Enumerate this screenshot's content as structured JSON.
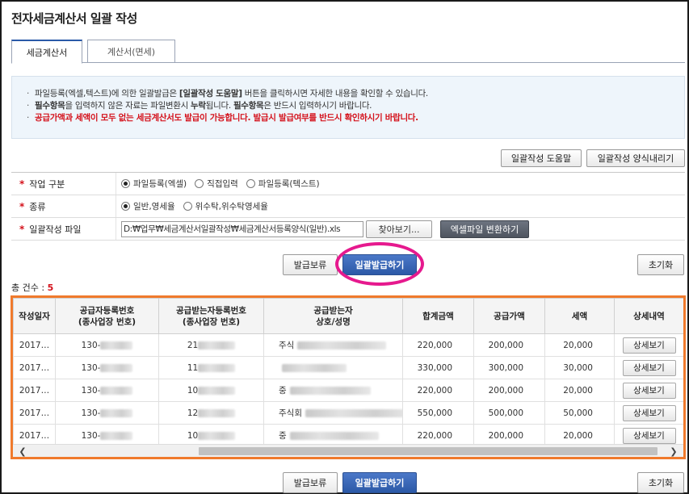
{
  "page": {
    "title": "전자세금계산서 일괄 작성"
  },
  "tabs": [
    {
      "label": "세금계산서",
      "active": true
    },
    {
      "label": "계산서(면세)",
      "active": false
    }
  ],
  "notice": {
    "line1_pre": "파일등록(엑셀,텍스트)에 의한 일괄발급은 ",
    "line1_bold": "[일괄작성 도움말]",
    "line1_post": " 버튼을 클릭하시면 자세한 내용을 확인할 수 있습니다.",
    "line2_b1": "필수항목",
    "line2_m1": "을 입력하지 않은 자료는 파일변환시 ",
    "line2_b2": "누락",
    "line2_m2": "됩니다. ",
    "line2_b3": "필수항목",
    "line2_m3": "은 반드시 입력하시기 바랍니다.",
    "line3": "공급가액과 세액이 모두 없는 세금계산서도 발급이 가능합니다. 발급시 발급여부를 반드시 확인하시기 바랍니다."
  },
  "toolbar": {
    "help_label": "일괄작성 도움말",
    "download_label": "일괄작성 양식내리기"
  },
  "form": {
    "work_type_label": "작업 구분",
    "work_type_options": [
      "파일등록(엑셀)",
      "직접입력",
      "파일등록(텍스트)"
    ],
    "kind_label": "종류",
    "kind_options": [
      "일반,영세율",
      "위수탁,위수탁영세율"
    ],
    "file_label": "일괄작성 파일",
    "file_path": "D:₩업무₩세금계산서일괄작성₩세금계산서등록양식(일반).xls",
    "browse_label": "찾아보기...",
    "convert_label": "엑셀파일 변환하기"
  },
  "actions": {
    "hold_label": "발급보류",
    "issue_label": "일괄발급하기",
    "reset_label": "초기화"
  },
  "summary": {
    "count_label": "총 건수 : ",
    "count": "5"
  },
  "table": {
    "headers": [
      "작성일자",
      "공급자등록번호\n(종사업장 번호)",
      "공급받는자등록번호\n(종사업장 번호)",
      "공급받는자\n상호/성명",
      "합계금액",
      "공급가액",
      "세액",
      "상세내역"
    ],
    "rows": [
      {
        "date": "2017…",
        "supplier_no": "130-",
        "buyer_no": "21",
        "buyer_name": "주식",
        "total": "220,000",
        "supply": "200,000",
        "tax": "20,000",
        "detail": "상세보기"
      },
      {
        "date": "2017…",
        "supplier_no": "130-",
        "buyer_no": "11",
        "buyer_name": "",
        "total": "330,000",
        "supply": "300,000",
        "tax": "30,000",
        "detail": "상세보기"
      },
      {
        "date": "2017…",
        "supplier_no": "130-",
        "buyer_no": "10",
        "buyer_name": "중",
        "total": "220,000",
        "supply": "200,000",
        "tax": "20,000",
        "detail": "상세보기"
      },
      {
        "date": "2017…",
        "supplier_no": "130-",
        "buyer_no": "12",
        "buyer_name": "주식회",
        "total": "550,000",
        "supply": "500,000",
        "tax": "50,000",
        "detail": "상세보기"
      },
      {
        "date": "2017…",
        "supplier_no": "130-",
        "buyer_no": "10",
        "buyer_name": "중",
        "total": "220,000",
        "supply": "200,000",
        "tax": "20,000",
        "detail": "상세보기"
      }
    ]
  },
  "colors": {
    "accent": "#2c59a7",
    "highlight": "#e6198e",
    "table_border": "#f07a2c",
    "required": "#d4111b"
  },
  "icons": {
    "scroll_left": "chevron-left-icon",
    "scroll_right": "chevron-right-icon"
  }
}
